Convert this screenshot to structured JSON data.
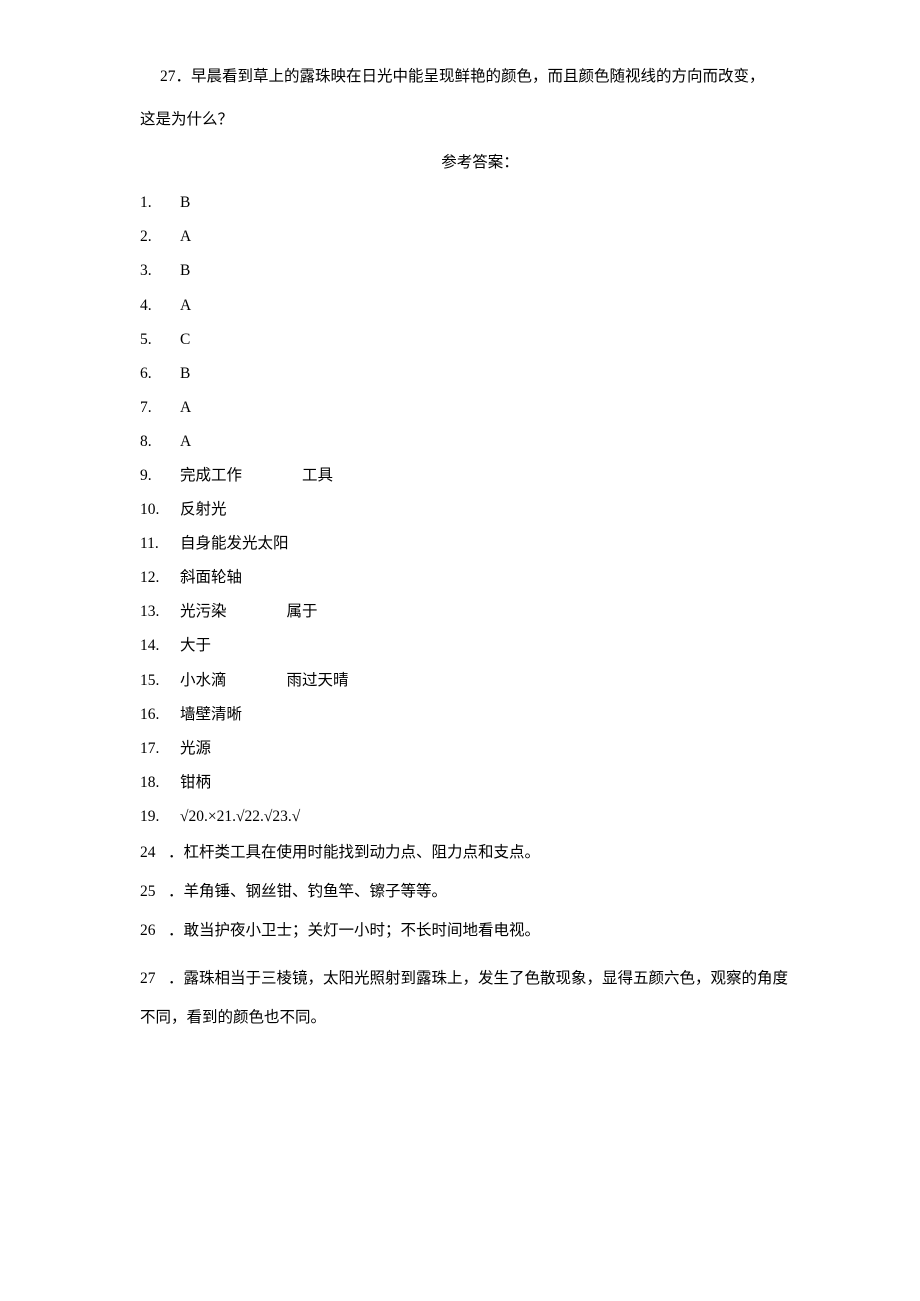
{
  "question": {
    "num": "27",
    "line1": "．早晨看到草上的露珠映在日光中能呈现鲜艳的颜色，而且颜色随视线的方向而改变，",
    "line2": "这是为什么？"
  },
  "heading": "参考答案：",
  "answers": [
    {
      "num": "1.",
      "text": "B"
    },
    {
      "num": "2.",
      "text": "A"
    },
    {
      "num": "3.",
      "text": "B"
    },
    {
      "num": "4.",
      "text": "A"
    },
    {
      "num": "5.",
      "text": "C"
    },
    {
      "num": "6.",
      "text": "B"
    },
    {
      "num": "7.",
      "text": "A"
    },
    {
      "num": "8.",
      "text": "A"
    },
    {
      "num": "9.",
      "text": "完成工作",
      "extra": "工具"
    },
    {
      "num": "10.",
      "text": "反射光"
    },
    {
      "num": "11.",
      "text": "自身能发光太阳"
    },
    {
      "num": "12.",
      "text": "斜面轮轴"
    },
    {
      "num": "13.",
      "text": "光污染",
      "extra": "属于"
    },
    {
      "num": "14.",
      "text": "大于"
    },
    {
      "num": "15.",
      "text": "小水滴",
      "extra": "雨过天晴"
    },
    {
      "num": "16.",
      "text": "墙壁清晰"
    },
    {
      "num": "17.",
      "text": "光源"
    },
    {
      "num": "18.",
      "text": "钳柄"
    },
    {
      "num": "19.",
      "text": "√20.×21.√22.√23.√"
    }
  ],
  "explanations": [
    {
      "num": "24",
      "text": "．杠杆类工具在使用时能找到动力点、阻力点和支点。"
    },
    {
      "num": "25",
      "text": "．羊角锤、钢丝钳、钓鱼竿、镲子等等。"
    },
    {
      "num": "26",
      "text": "．敢当护夜小卫士；关灯一小时；不长时间地看电视。"
    }
  ],
  "final": {
    "num": "27",
    "line1": "．露珠相当于三棱镜，太阳光照射到露珠上，发生了色散现象，显得五颜六色，观察的角度",
    "line2": "不同，看到的颜色也不同。"
  }
}
